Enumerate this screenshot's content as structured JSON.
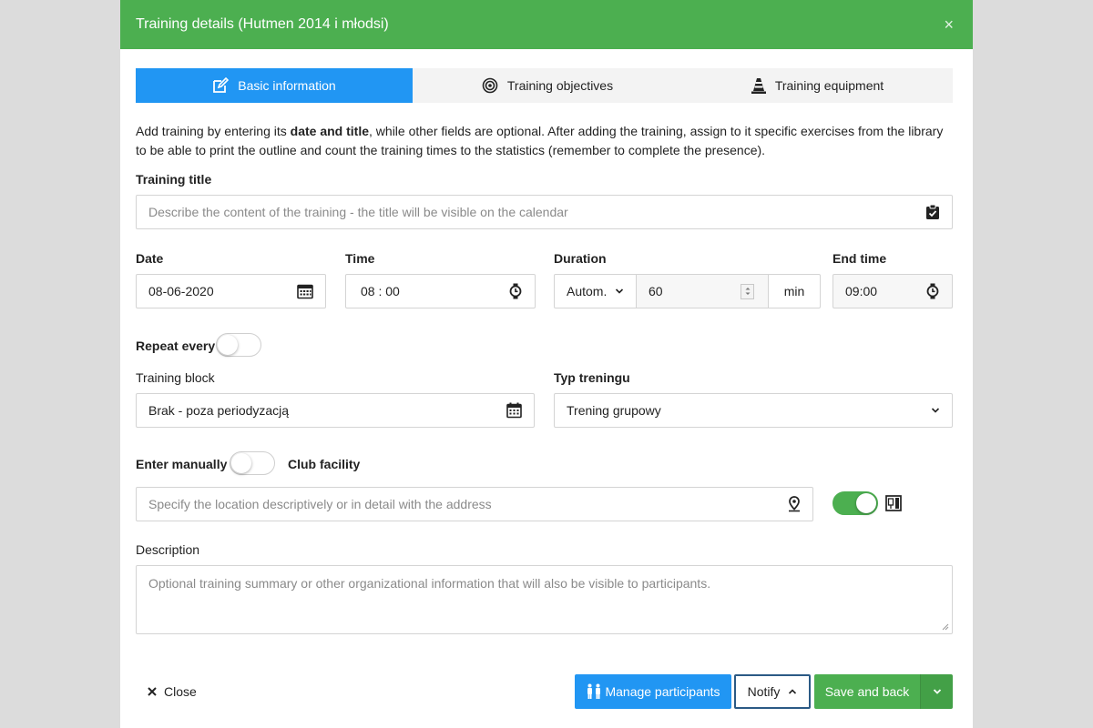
{
  "modal": {
    "title": "Training details (Hutmen 2014 i młodsi)",
    "close_glyph": "×"
  },
  "tabs": [
    {
      "label": "Basic information",
      "icon": "edit-icon",
      "active": true
    },
    {
      "label": "Training objectives",
      "icon": "target-icon",
      "active": false
    },
    {
      "label": "Training equipment",
      "icon": "cone-icon",
      "active": false
    }
  ],
  "intro": {
    "part1": "Add training by entering its ",
    "bold": "date and title",
    "part2": ", while other fields are optional. After adding the training, assign to it specific exercises from the library to be able to print the outline and count the training times to the statistics (remember to complete the presence)."
  },
  "training_title": {
    "label": "Training title",
    "placeholder": "Describe the content of the training - the title will be visible on the calendar"
  },
  "date": {
    "label": "Date",
    "value": "08-06-2020"
  },
  "time": {
    "label": "Time",
    "value": "08 : 00"
  },
  "duration": {
    "label": "Duration",
    "mode": "Autom.",
    "value": "60",
    "unit": "min"
  },
  "end_time": {
    "label": "End time",
    "value": "09:00"
  },
  "repeat": {
    "label": "Repeat every",
    "on": false
  },
  "training_block": {
    "label": "Training block",
    "value": "Brak - poza periodyzacją"
  },
  "training_type": {
    "label": "Typ treningu",
    "value": "Trening grupowy"
  },
  "location": {
    "manual_label": "Enter manually",
    "manual_on": false,
    "facility_label": "Club facility",
    "placeholder": "Specify the location descriptively or in detail with the address",
    "facility_on": true
  },
  "description": {
    "label": "Description",
    "placeholder": "Optional training summary or other organizational information that will also be visible to participants."
  },
  "footer": {
    "close_label": "Close",
    "manage_label": "Manage participants",
    "notify_label": "Notify",
    "save_label": "Save and back"
  },
  "colors": {
    "header": "#4caf50",
    "primary": "#2196f3",
    "success": "#4caf50",
    "notify_border": "#2b5a85"
  }
}
